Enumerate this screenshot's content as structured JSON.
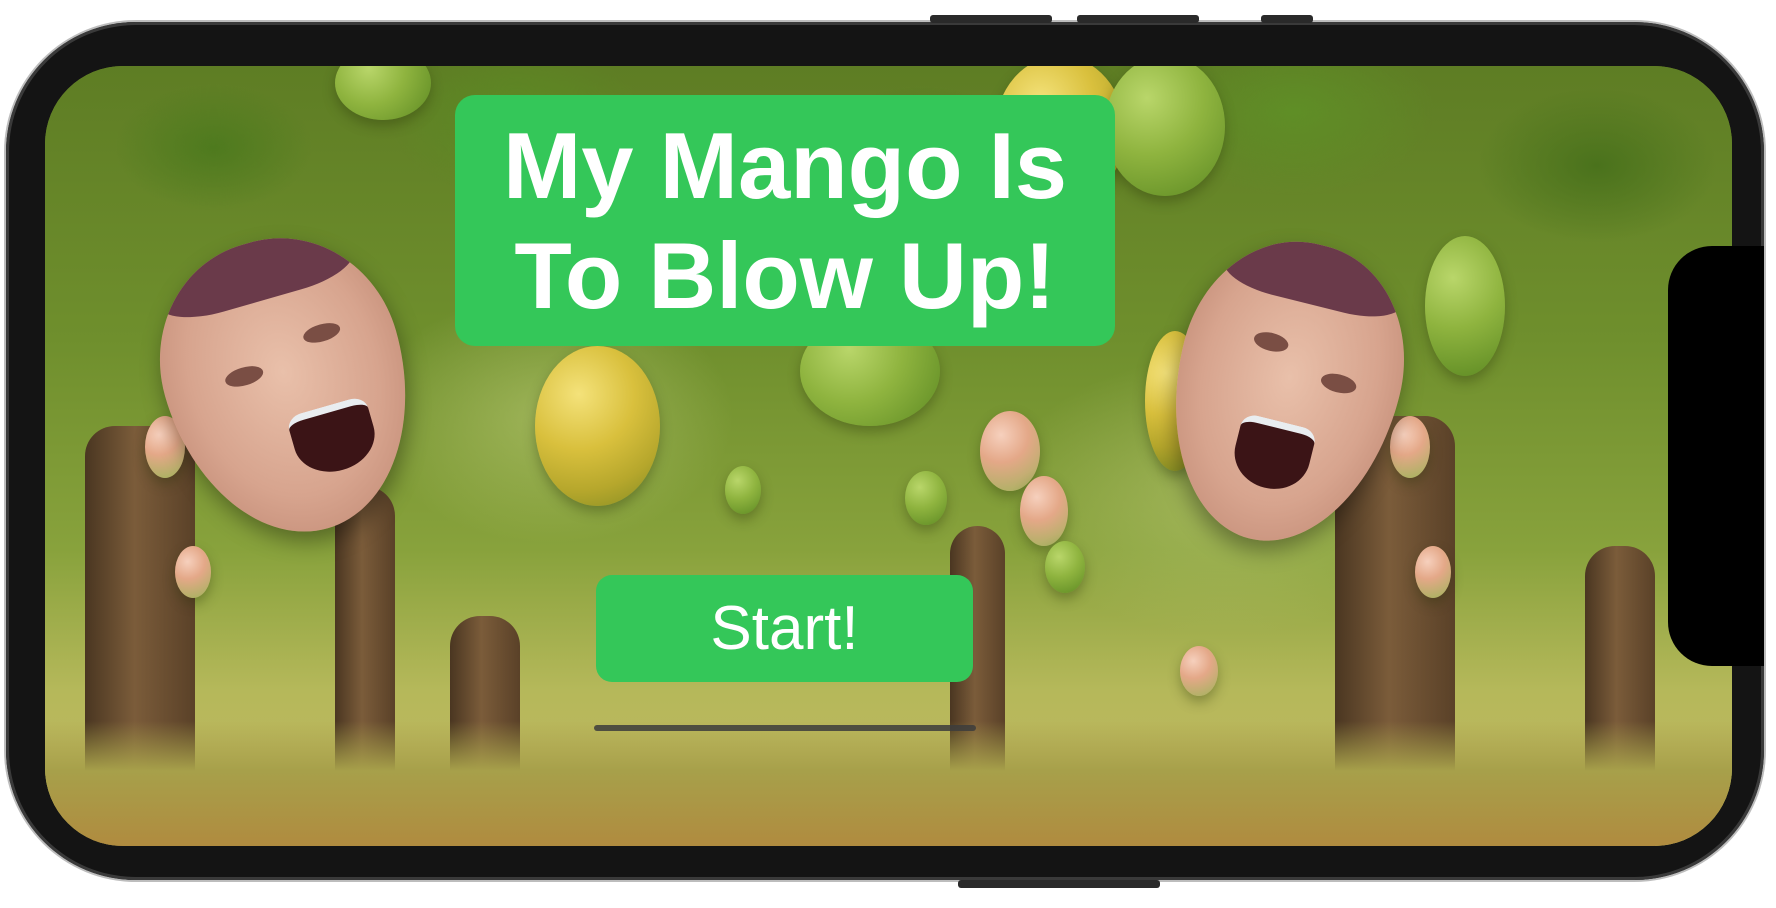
{
  "game": {
    "title": "My Mango Is To Blow Up!",
    "start_label": "Start!"
  },
  "colors": {
    "panel_green": "#34c759",
    "text": "#ffffff",
    "device_frame": "#141414"
  },
  "sprites": [
    "face-left",
    "face-right"
  ]
}
